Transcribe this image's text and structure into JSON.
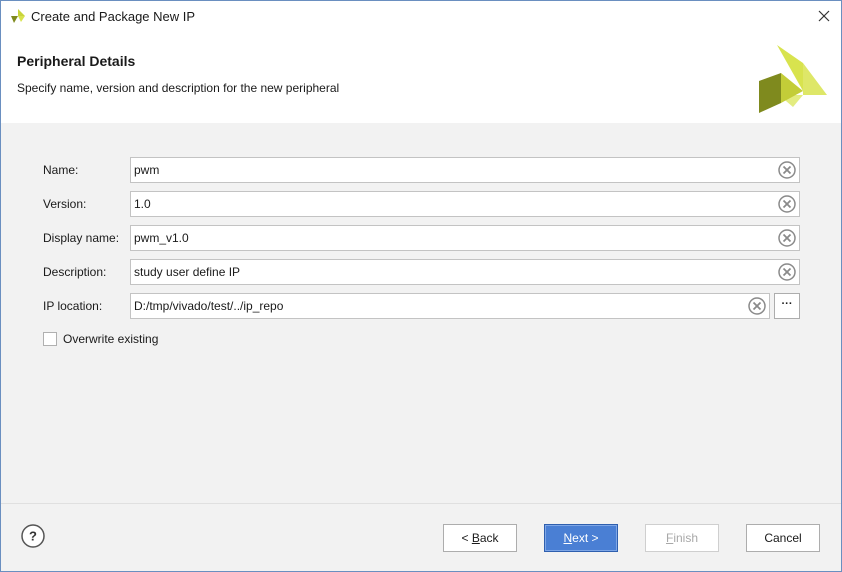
{
  "window": {
    "title": "Create and Package New IP"
  },
  "header": {
    "title": "Peripheral Details",
    "subtitle": "Specify name, version and description for the new peripheral"
  },
  "form": {
    "fields": [
      {
        "label": "Name:",
        "value": "pwm"
      },
      {
        "label": "Version:",
        "value": "1.0"
      },
      {
        "label": "Display name:",
        "value": "pwm_v1.0"
      },
      {
        "label": "Description:",
        "value": "study user define IP"
      },
      {
        "label": "IP location:",
        "value": "D:/tmp/vivado/test/../ip_repo"
      }
    ],
    "browse_label": "···",
    "overwrite": {
      "label": "Overwrite existing",
      "checked": false
    }
  },
  "footer": {
    "help_label": "?",
    "back": {
      "prefix": "< ",
      "mnemonic": "B",
      "rest": "ack"
    },
    "next": {
      "mnemonic": "N",
      "rest": "ext >"
    },
    "finish": {
      "mnemonic": "F",
      "rest": "inish"
    },
    "cancel": "Cancel"
  },
  "colors": {
    "primary_button": "#4a7fd4",
    "logo_light": "#d8e34e",
    "logo_dark": "#7f8a1e",
    "content_bg": "#f2f2f2"
  },
  "icons": {
    "app": "vivado-logo-icon",
    "close": "close-icon",
    "clear": "clear-circle-icon",
    "help": "help-circle-icon"
  }
}
